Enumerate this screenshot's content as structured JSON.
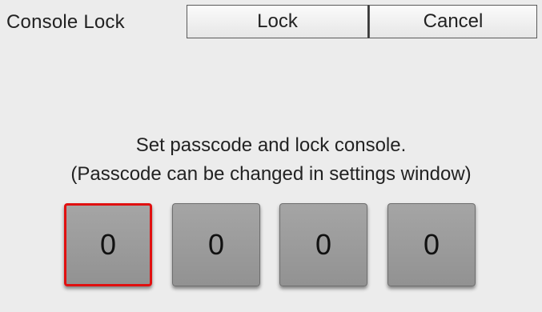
{
  "window": {
    "title": "Console Lock"
  },
  "toolbar": {
    "lock_label": "Lock",
    "cancel_label": "Cancel"
  },
  "message": {
    "line1": "Set passcode and lock console.",
    "line2": "(Passcode can be changed in settings window)"
  },
  "passcode": {
    "digits": [
      "0",
      "0",
      "0",
      "0"
    ],
    "selected_index": 0
  },
  "colors": {
    "selected_border": "#e01010",
    "digit_fill": "#9b9b9b",
    "background": "#ececec"
  }
}
